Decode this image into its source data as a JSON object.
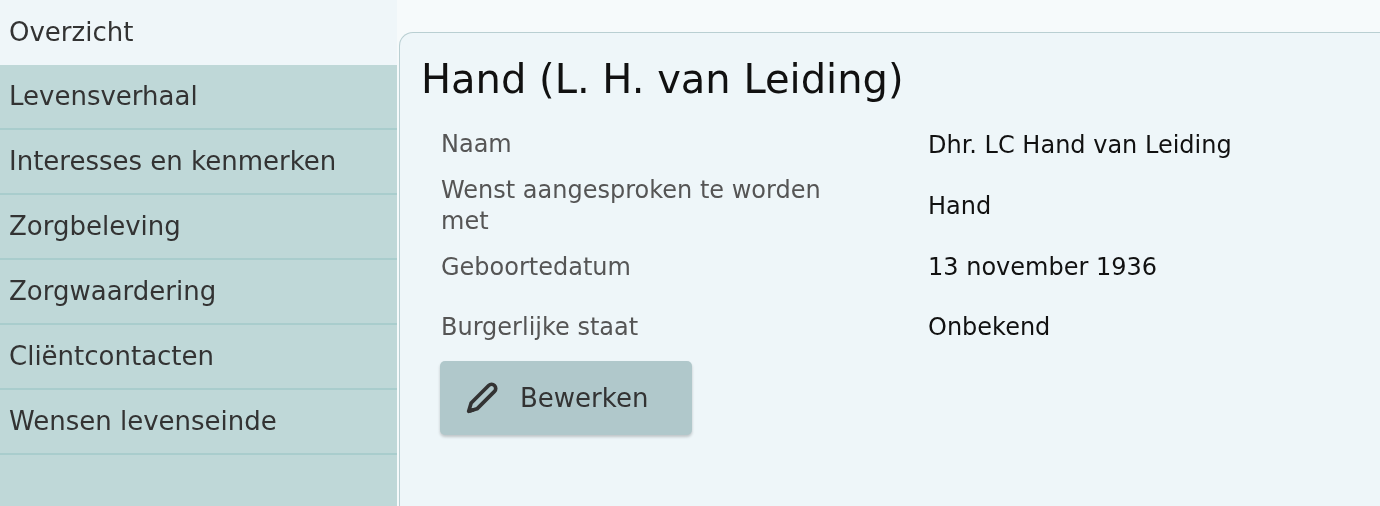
{
  "sidebar": {
    "items": [
      {
        "label": "Overzicht",
        "selected": true
      },
      {
        "label": "Levensverhaal",
        "selected": false
      },
      {
        "label": "Interesses en kenmerken",
        "selected": false
      },
      {
        "label": "Zorgbeleving",
        "selected": false
      },
      {
        "label": "Zorgwaardering",
        "selected": false
      },
      {
        "label": "Cliëntcontacten",
        "selected": false
      },
      {
        "label": "Wensen levenseinde",
        "selected": false
      }
    ]
  },
  "card": {
    "title": "Hand (L. H. van Leiding)",
    "fields": [
      {
        "label": "Naam",
        "value": "Dhr. LC Hand van Leiding"
      },
      {
        "label": "Wenst aangesproken te worden met",
        "value": "Hand"
      },
      {
        "label": "Geboortedatum",
        "value": "13 november 1936"
      },
      {
        "label": "Burgerlijke staat",
        "value": "Onbekend"
      }
    ],
    "edit_button": "Bewerken"
  }
}
